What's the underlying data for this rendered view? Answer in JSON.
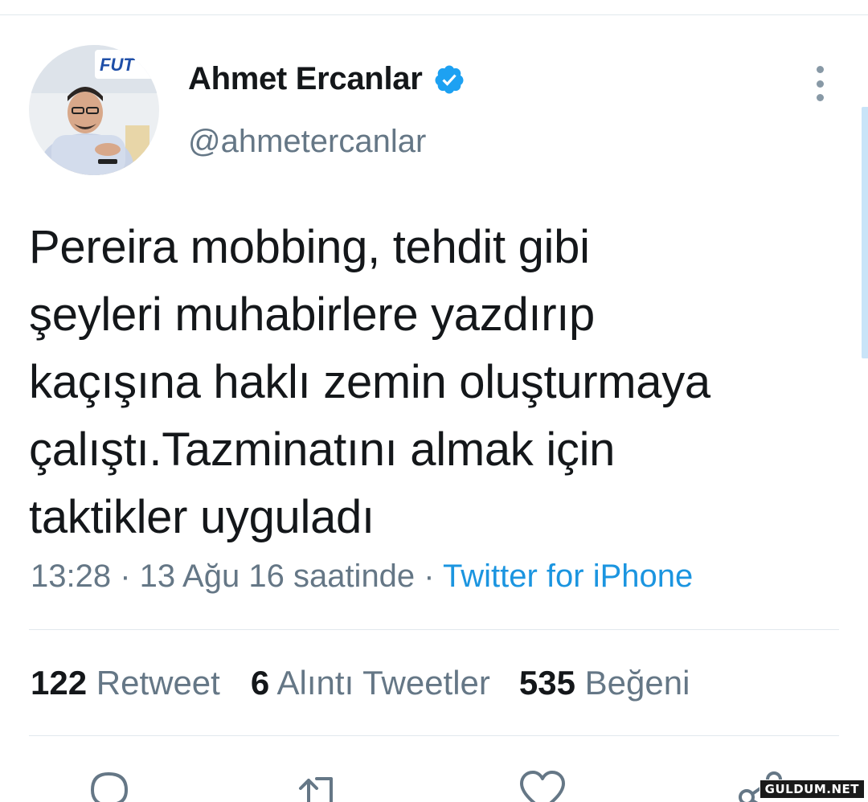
{
  "author": {
    "display_name": "Ahmet Ercanlar",
    "handle": "@ahmetercanlar",
    "avatar_icon": "profile-photo",
    "verified_icon": "verified-badge-icon"
  },
  "tweet": {
    "text_lines": [
      "Pereira mobbing, tehdit gibi",
      "şeyleri muhabirlere yazdırıp",
      "kaçışına haklı zemin oluşturmaya",
      "çalıştı.Tazminatını almak için",
      "taktikler uyguladı"
    ],
    "time": "13:28",
    "separator": " · ",
    "date": "13 Ağu 16 saatinde",
    "source": "Twitter for iPhone"
  },
  "stats": {
    "retweets": {
      "count": "122",
      "label": "Retweet"
    },
    "quotes": {
      "count": "6",
      "label": "Alıntı Tweetler"
    },
    "likes": {
      "count": "535",
      "label": "Beğeni"
    }
  },
  "actions": [
    "reply-icon",
    "retweet-icon",
    "like-icon",
    "share-icon"
  ],
  "watermark": "GULDUM.NET",
  "colors": {
    "link": "#1b95e0",
    "secondary_text": "#657786",
    "primary_text": "#14171a",
    "verified": "#1da1f2",
    "icon": "#657786"
  }
}
